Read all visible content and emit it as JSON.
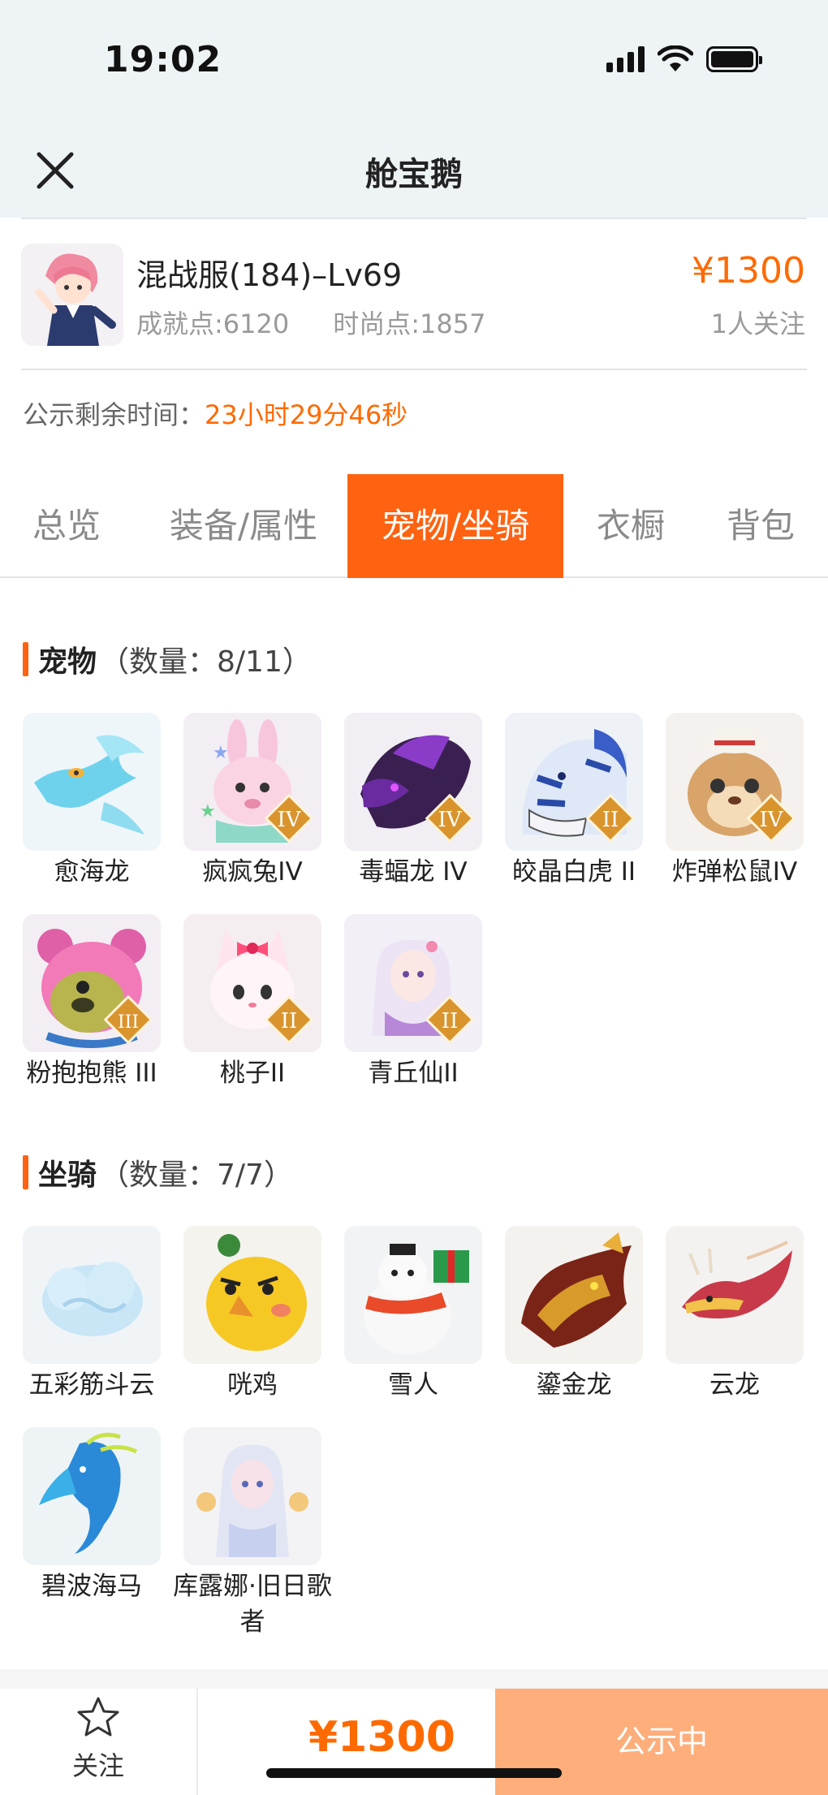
{
  "status_bar": {
    "time": "19:02"
  },
  "header": {
    "title": "舱宝鹅"
  },
  "account": {
    "server": "混战服(184)–Lv69",
    "achievement": "成就点:6120",
    "fashion": "时尚点:1857",
    "price": "¥1300",
    "followers": "1人关注"
  },
  "notice": {
    "label": "公示剩余时间：",
    "value": "23小时29分46秒"
  },
  "tabs": [
    "总览",
    "装备/属性",
    "宠物/坐骑",
    "衣橱",
    "背包"
  ],
  "pets": {
    "title": "宠物",
    "count": "（数量：8/11）",
    "items": [
      {
        "name": "愈海龙",
        "rank": ""
      },
      {
        "name": "疯疯兔IV",
        "rank": "IV"
      },
      {
        "name": "毒蝠龙 IV",
        "rank": "IV"
      },
      {
        "name": "皎晶白虎 II",
        "rank": "II"
      },
      {
        "name": "炸弹松鼠IV",
        "rank": "IV"
      },
      {
        "name": "粉抱抱熊 III",
        "rank": "III"
      },
      {
        "name": "桃子II",
        "rank": "II"
      },
      {
        "name": "青丘仙II",
        "rank": "II"
      }
    ]
  },
  "mounts": {
    "title": "坐骑",
    "count": "（数量：7/7）",
    "items": [
      {
        "name": "五彩筋斗云"
      },
      {
        "name": "咣鸡"
      },
      {
        "name": "雪人"
      },
      {
        "name": "鎏金龙"
      },
      {
        "name": "云龙"
      },
      {
        "name": "碧波海马"
      },
      {
        "name": "库露娜·旧日歌者"
      }
    ]
  },
  "bottom": {
    "follow_label": "关注",
    "price": "¥1300",
    "status": "公示中"
  },
  "colors": {
    "accent": "#ff6210",
    "price": "#ff6a00",
    "status_button": "#fdae7b"
  }
}
